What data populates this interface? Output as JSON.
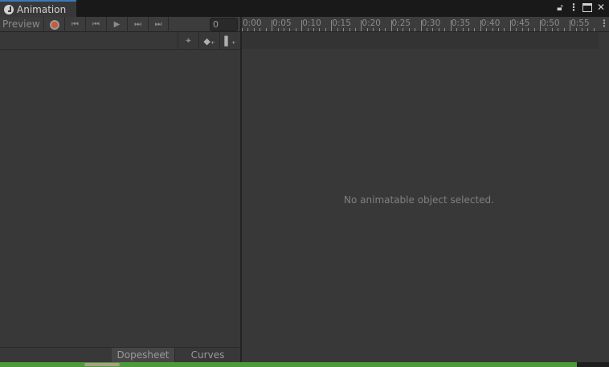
{
  "window": {
    "tab_title": "Animation",
    "icons": [
      "lock-icon",
      "menu-icon",
      "maximize-icon",
      "close-icon"
    ]
  },
  "toolbar": {
    "preview_label": "Preview",
    "frame_value": "0",
    "buttons": [
      "record",
      "first-key",
      "prev-key",
      "play",
      "next-key",
      "last-key"
    ]
  },
  "row2": {
    "buttons": [
      "filter-by-selection",
      "add-keyframe",
      "add-event"
    ]
  },
  "timeline": {
    "ticks": [
      "0:00",
      "0:05",
      "0:10",
      "0:15",
      "0:20",
      "0:25",
      "0:30",
      "0:35",
      "0:40",
      "0:45",
      "0:50",
      "0:55"
    ]
  },
  "main": {
    "empty_message": "No animatable object selected."
  },
  "bottom_tabs": {
    "dopesheet": "Dopesheet",
    "curves": "Curves"
  },
  "colors": {
    "accent": "#3a79bb",
    "record": "#c95b3d",
    "status_bar": "#4d9a3a"
  }
}
